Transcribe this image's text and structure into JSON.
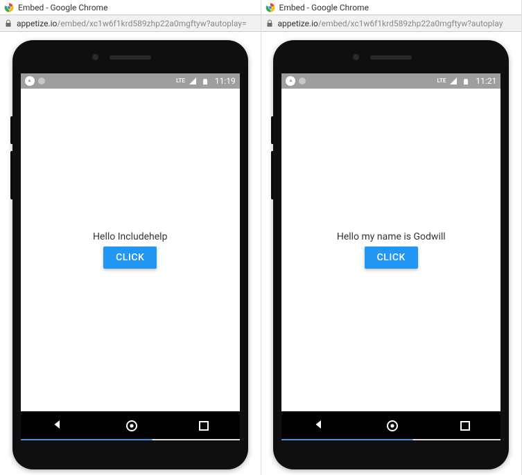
{
  "windows": [
    {
      "title": "Embed - Google Chrome",
      "url_host": "appetize.io",
      "url_path": "/embed/xc1w6f1krd589zhp22a0mgftyw?autoplay=",
      "statusbar": {
        "lte": "LTE",
        "time": "11:19"
      },
      "app": {
        "text": "Hello Includehelp",
        "button": "CLICK"
      }
    },
    {
      "title": "Embed - Google Chrome",
      "url_host": "appetize.io",
      "url_path": "/embed/xc1w6f1krd589zhp22a0mgftyw?autoplay",
      "statusbar": {
        "lte": "LTE",
        "time": "11:21"
      },
      "app": {
        "text": "Hello my name is Godwill",
        "button": "CLICK"
      }
    }
  ]
}
